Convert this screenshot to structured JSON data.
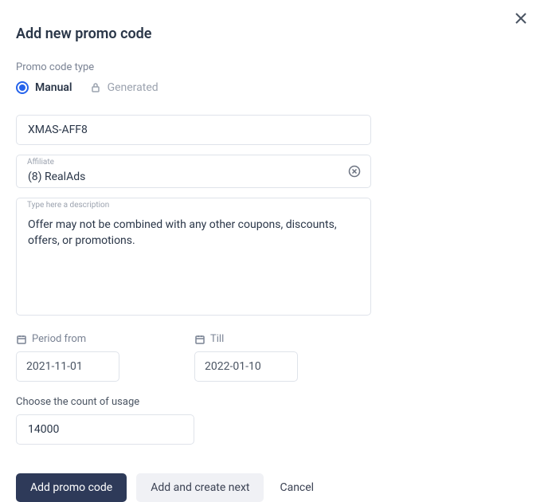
{
  "modal": {
    "title": "Add new promo code"
  },
  "typeSection": {
    "label": "Promo code type",
    "options": {
      "manual": "Manual",
      "generated": "Generated"
    }
  },
  "fields": {
    "code": {
      "value": "XMAS-AFF8"
    },
    "affiliate": {
      "label": "Affiliate",
      "value": "(8) RealAds"
    },
    "description": {
      "placeholder": "Type here a description",
      "value": "Offer may not be combined with any other coupons, discounts, offers, or promotions."
    },
    "periodFrom": {
      "label": "Period from",
      "value": "2021-11-01"
    },
    "periodTill": {
      "label": "Till",
      "value": "2022-01-10"
    },
    "usage": {
      "label": "Choose the count of usage",
      "value": "14000"
    }
  },
  "actions": {
    "primary": "Add promo code",
    "secondary": "Add and create next",
    "cancel": "Cancel"
  }
}
